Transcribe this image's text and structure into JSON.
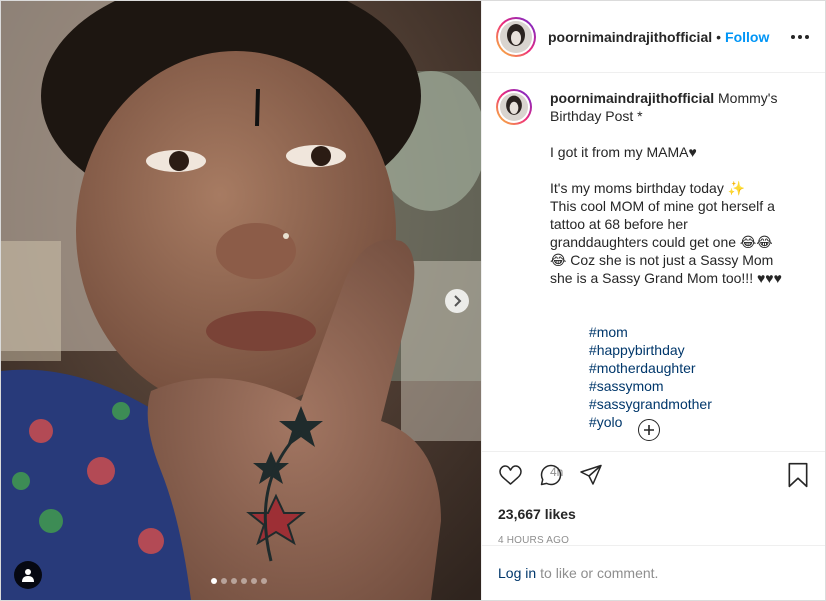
{
  "post": {
    "username": "poornimaindrajithofficial",
    "separator": "•",
    "follow_label": "Follow",
    "more_icon": "more-options-icon",
    "caption": {
      "username": "poornimaindrajithofficial",
      "text": " Mommy's Birthday Post *\n\nI got it from my MAMA♥\n\nIt's my moms birthday today ✨\nThis cool MOM of mine got herself a tattoo at 68 before her granddaughters could get one 😂😂😂 Coz she is not just a Sassy Mom she is a Sassy Grand Mom too!!! ♥♥♥",
      "hashtags": [
        "#mom",
        "#happybirthday",
        "#motherdaughter",
        "#sassymom",
        "#sassygrandmother",
        "#yolo"
      ],
      "time_ago": "4h"
    },
    "likes": "23,667 likes",
    "date": "4 HOURS AGO",
    "login_link": "Log in",
    "login_text": "to like or comment.",
    "carousel": {
      "total": 6,
      "active_index": 0
    },
    "colors": {
      "accent": "#0095f6",
      "link": "#00376b",
      "muted": "#8e8e8e"
    }
  }
}
